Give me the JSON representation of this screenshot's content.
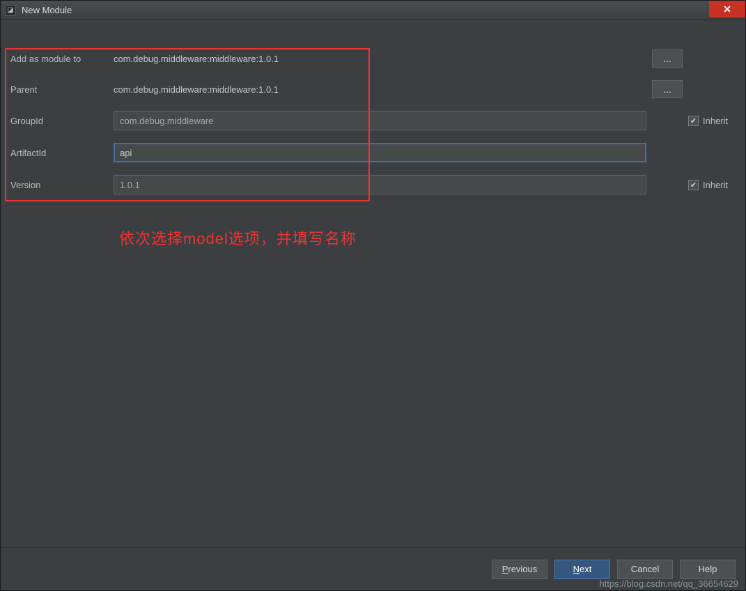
{
  "window": {
    "title": "New Module",
    "icon_name": "app-icon"
  },
  "form": {
    "add_as_module": {
      "label": "Add as module to",
      "value": "com.debug.middleware:middleware:1.0.1",
      "browse_label": "..."
    },
    "parent": {
      "label": "Parent",
      "value": "com.debug.middleware:middleware:1.0.1",
      "browse_label": "..."
    },
    "group_id": {
      "label": "GroupId",
      "value": "com.debug.middleware",
      "inherit_label": "Inherit",
      "inherit_checked": true
    },
    "artifact_id": {
      "label": "ArtifactId",
      "value": "api"
    },
    "version": {
      "label": "Version",
      "value": "1.0.1",
      "inherit_label": "Inherit",
      "inherit_checked": true
    }
  },
  "annotation": "依次选择model选项，并填写名称",
  "footer": {
    "previous": "Previous",
    "next": "Next",
    "cancel": "Cancel",
    "help": "Help"
  },
  "watermark": "https://blog.csdn.net/qq_36654629"
}
